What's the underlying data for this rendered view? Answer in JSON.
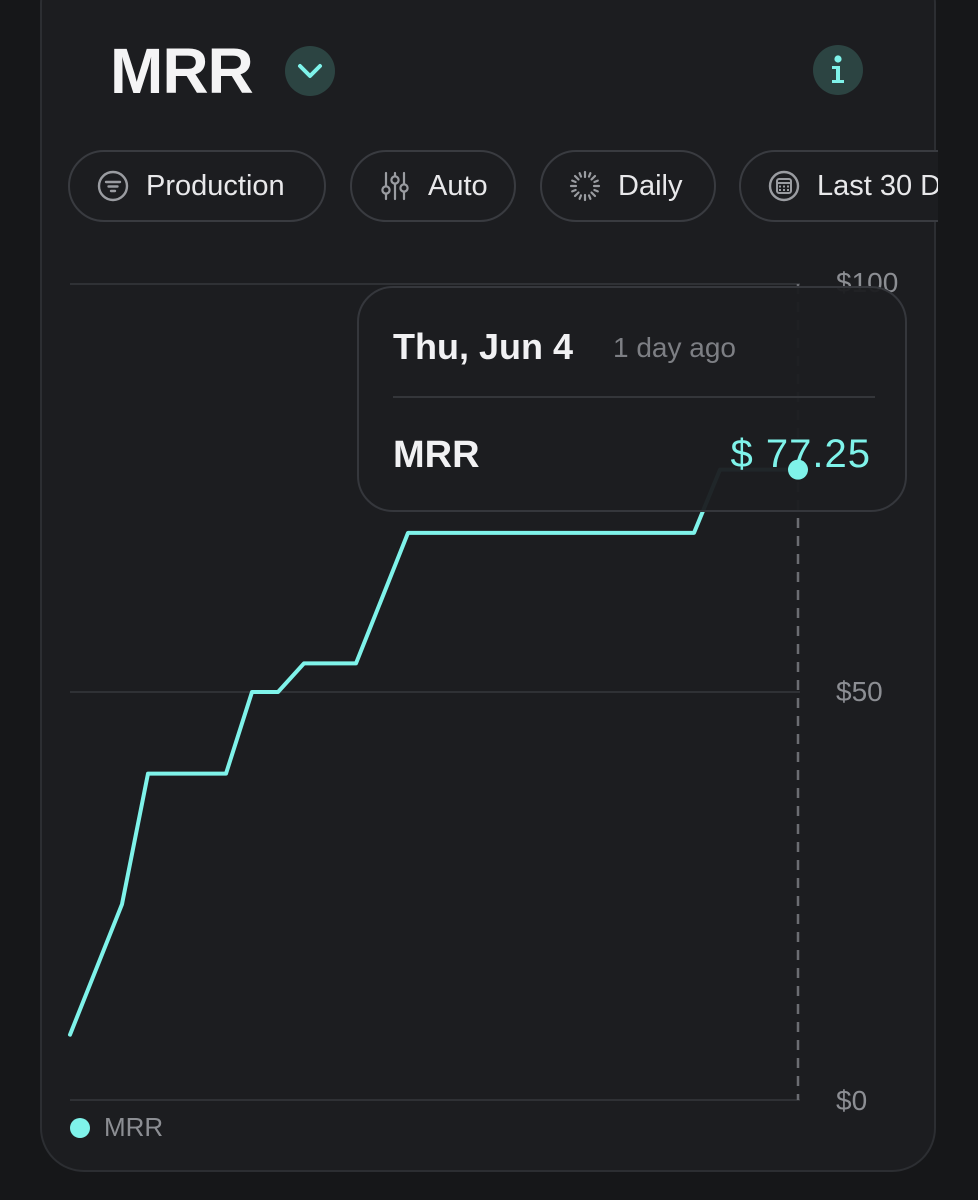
{
  "header": {
    "title": "MRR",
    "dropdown_icon": "chevron-down-icon",
    "info_icon": "info-icon"
  },
  "filters": [
    {
      "label": "Production",
      "icon": "filter-icon"
    },
    {
      "label": "Auto",
      "icon": "sliders-icon"
    },
    {
      "label": "Daily",
      "icon": "interval-icon"
    },
    {
      "label": "Last 30 D",
      "icon": "calendar-icon"
    }
  ],
  "tooltip": {
    "date": "Thu, Jun 4",
    "relative": "1 day ago",
    "series": "MRR",
    "value": "$  77.25"
  },
  "colors": {
    "accent": "#7ff3ea",
    "background": "#1c1d20",
    "grid": "#2f3135"
  },
  "chart_data": {
    "type": "line",
    "ylim": [
      0,
      100
    ],
    "yticks": [
      "$0",
      "$50",
      "$100"
    ],
    "ytick_values": [
      0,
      50,
      100
    ],
    "x": [
      0,
      2,
      3,
      6,
      7,
      8,
      9,
      11,
      13,
      24,
      25,
      28
    ],
    "values": [
      8,
      24,
      40,
      40,
      50,
      50,
      53.5,
      53.5,
      69.5,
      69.5,
      77.25,
      77.25
    ],
    "grid": true,
    "legend": "bottom-left",
    "series": [
      {
        "name": "MRR",
        "color": "#7ff3ea"
      }
    ]
  }
}
